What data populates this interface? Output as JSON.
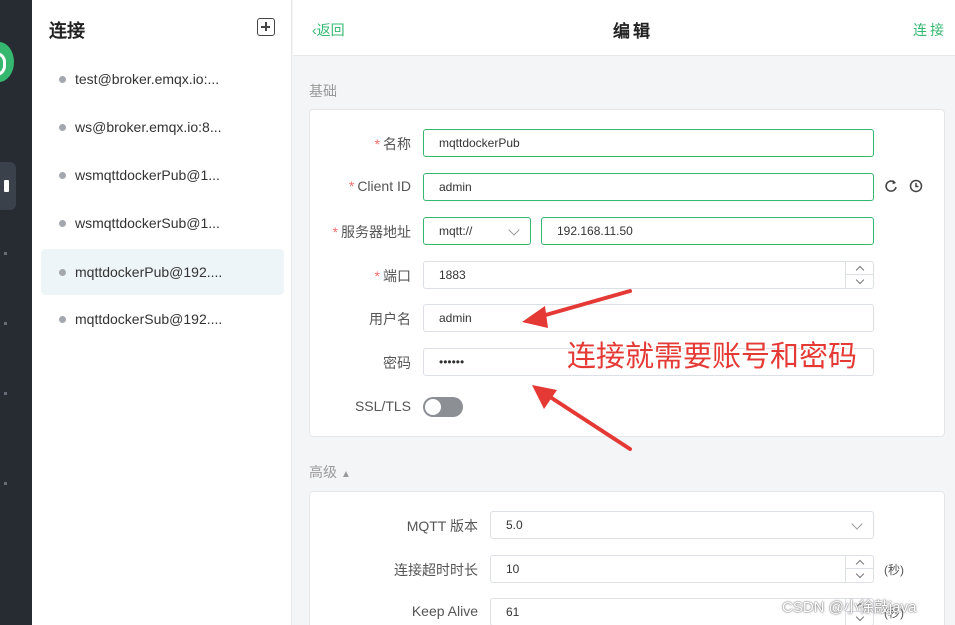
{
  "sidebar": {
    "title": "连接",
    "connections": [
      {
        "label": "test@broker.emqx.io:...",
        "selected": false
      },
      {
        "label": "ws@broker.emqx.io:8...",
        "selected": false
      },
      {
        "label": "wsmqttdockerPub@1...",
        "selected": false
      },
      {
        "label": "wsmqttdockerSub@1...",
        "selected": false
      },
      {
        "label": "mqttdockerPub@192....",
        "selected": true
      },
      {
        "label": "mqttdockerSub@192....",
        "selected": false
      }
    ]
  },
  "header": {
    "back_label": "返回",
    "title": "编辑",
    "connect_label": "连接"
  },
  "basic": {
    "section_label": "基础",
    "name_label": "名称",
    "name_value": "mqttdockerPub",
    "client_id_label": "Client ID",
    "client_id_value": "admin",
    "server_label": "服务器地址",
    "protocol_value": "mqtt://",
    "host_value": "192.168.11.50",
    "port_label": "端口",
    "port_value": "1883",
    "username_label": "用户名",
    "username_value": "admin",
    "password_label": "密码",
    "password_value": "••••••",
    "ssl_label": "SSL/TLS"
  },
  "advanced": {
    "section_label": "高级",
    "mqtt_version_label": "MQTT 版本",
    "mqtt_version_value": "5.0",
    "timeout_label": "连接超时时长",
    "timeout_value": "10",
    "timeout_unit": "(秒)",
    "keepalive_label": "Keep Alive",
    "keepalive_value": "61",
    "keepalive_unit": "(秒)"
  },
  "annotation": "连接就需要账号和密码",
  "watermark": "CSDN @小徐敲java",
  "colors": {
    "accent": "#35b770",
    "annotation": "#e53935",
    "rail": "#272c33"
  }
}
